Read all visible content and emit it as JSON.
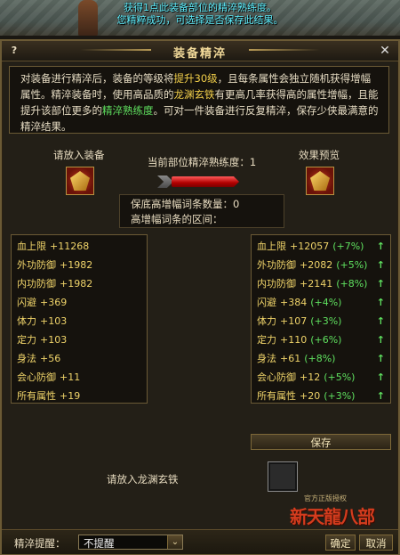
{
  "notification": {
    "line1": "获得1点此装备部位的精淬熟练度。",
    "line2": "您精粹成功，可选择是否保存此结果。"
  },
  "window": {
    "title": "装备精淬",
    "help_label": "?",
    "close_label": "✕"
  },
  "description": {
    "t1": "对装备进行精淬后，装备的等级将",
    "h1": "提升30级",
    "t2": "，且每条属性会独立随机获得增幅属性。精淬装备时，使用高品质的",
    "h2": "龙渊玄铁",
    "t3": "有更高几率获得高的属性增幅，且能提升该部位更多的",
    "h3": "精淬熟练度",
    "t4": "。可对一件装备进行反复精淬，保存少侠最满意的精淬结果。"
  },
  "equip_slot": {
    "label": "请放入装备"
  },
  "preview_slot": {
    "label": "效果预览"
  },
  "proficiency": {
    "label": "当前部位精淬熟练度：1",
    "level": 1
  },
  "info": {
    "guarantee_label": "保底高增幅词条数量：0",
    "range_label": "高增幅词条的区间："
  },
  "current_attrs": [
    {
      "name": "血上限",
      "value": "+11268"
    },
    {
      "name": "外功防御",
      "value": "+1982"
    },
    {
      "name": "内功防御",
      "value": "+1982"
    },
    {
      "name": "闪避",
      "value": "+369"
    },
    {
      "name": "体力",
      "value": "+103"
    },
    {
      "name": "定力",
      "value": "+103"
    },
    {
      "name": "身法",
      "value": "+56"
    },
    {
      "name": "会心防御",
      "value": "+11"
    },
    {
      "name": "所有属性",
      "value": "+19"
    }
  ],
  "preview_attrs": [
    {
      "name": "血上限",
      "value": "+12057",
      "pct": "(+7%)",
      "arrow": "↑"
    },
    {
      "name": "外功防御",
      "value": "+2082",
      "pct": "(+5%)",
      "arrow": "↑"
    },
    {
      "name": "内功防御",
      "value": "+2141",
      "pct": "(+8%)",
      "arrow": "↑"
    },
    {
      "name": "闪避",
      "value": "+384",
      "pct": "(+4%)",
      "arrow": "↑"
    },
    {
      "name": "体力",
      "value": "+107",
      "pct": "(+3%)",
      "arrow": "↑"
    },
    {
      "name": "定力",
      "value": "+110",
      "pct": "(+6%)",
      "arrow": "↑"
    },
    {
      "name": "身法",
      "value": "+61",
      "pct": "(+8%)",
      "arrow": "↑"
    },
    {
      "name": "会心防御",
      "value": "+12",
      "pct": "(+5%)",
      "arrow": "↑"
    },
    {
      "name": "所有属性",
      "value": "+20",
      "pct": "(+3%)",
      "arrow": "↑"
    }
  ],
  "buttons": {
    "save": "保存",
    "confirm": "确定",
    "cancel": "取消"
  },
  "material": {
    "label": "请放入龙渊玄铁"
  },
  "logo": {
    "small": "官方正版授权",
    "big": "新天龍八部"
  },
  "reminder": {
    "label": "精淬提醒：",
    "value": "不提醒"
  },
  "colors": {
    "notification": "#5ff0ff",
    "highlight": "#f3d04a",
    "green": "#5fe05f",
    "attr": "#f0d46a"
  }
}
